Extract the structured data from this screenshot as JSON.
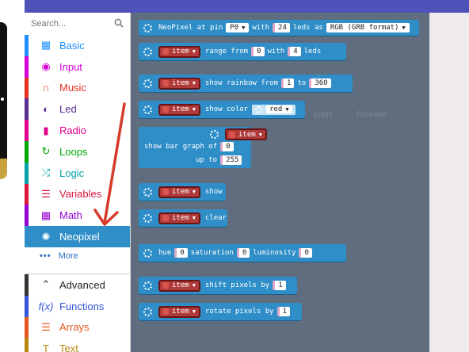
{
  "search": {
    "placeholder": "Search..."
  },
  "toolbox": {
    "categories": [
      {
        "label": "Basic",
        "color": "#1e90ff",
        "icon": "grid-icon"
      },
      {
        "label": "Input",
        "color": "#d400d4",
        "icon": "target-icon"
      },
      {
        "label": "Music",
        "color": "#e63022",
        "icon": "headphones-icon"
      },
      {
        "label": "Led",
        "color": "#5c2d91",
        "icon": "toggle-icon"
      },
      {
        "label": "Radio",
        "color": "#e3008c",
        "icon": "antenna-icon"
      },
      {
        "label": "Loops",
        "color": "#00aa00",
        "icon": "loop-icon"
      },
      {
        "label": "Logic",
        "color": "#00a4a6",
        "icon": "shuffle-icon"
      },
      {
        "label": "Variables",
        "color": "#dc143c",
        "icon": "list-icon"
      },
      {
        "label": "Math",
        "color": "#9400d3",
        "icon": "calculator-icon"
      },
      {
        "label": "Neopixel",
        "color": "#2f8ec8",
        "icon": "sun-icon"
      }
    ],
    "more": "More",
    "advanced": [
      {
        "label": "Advanced",
        "color": "#333333",
        "icon": "chevron-up-icon"
      },
      {
        "label": "Functions",
        "color": "#3455db",
        "icon": "function-icon"
      },
      {
        "label": "Arrays",
        "color": "#e65722",
        "icon": "list-icon"
      },
      {
        "label": "Text",
        "color": "#b8860b",
        "icon": "text-icon"
      }
    ]
  },
  "blocks": {
    "neopixel_at_pin": {
      "text": "NeoPixel at pin",
      "pin": "P0",
      "with": "with",
      "leds_count": "24",
      "leds_as": "leds as",
      "format": "RGB (GRB format)"
    },
    "range": {
      "item": "item",
      "range_from": "range from",
      "from": "0",
      "with": "with",
      "count": "4",
      "leds": "leds"
    },
    "rainbow": {
      "item": "item",
      "text": "show rainbow from",
      "from": "1",
      "to": "to",
      "to_value": "360"
    },
    "show_color": {
      "item": "item",
      "text": "show color",
      "color": "red"
    },
    "bar_graph": {
      "item": "item",
      "label": "show bar graph of",
      "value": "0",
      "up_to": "up to",
      "max": "255"
    },
    "show": {
      "item": "item",
      "text": "show"
    },
    "clear": {
      "item": "item",
      "text": "clear"
    },
    "hsl": {
      "hue": "hue",
      "h": "0",
      "saturation": "saturation",
      "s": "0",
      "luminosity": "luminosity",
      "l": "0"
    },
    "shift": {
      "item": "item",
      "text": "shift pixels by",
      "value": "1"
    },
    "rotate": {
      "item": "item",
      "text": "rotate pixels by",
      "value": "1"
    }
  },
  "ghost": {
    "start": "start",
    "forever": "forever"
  }
}
